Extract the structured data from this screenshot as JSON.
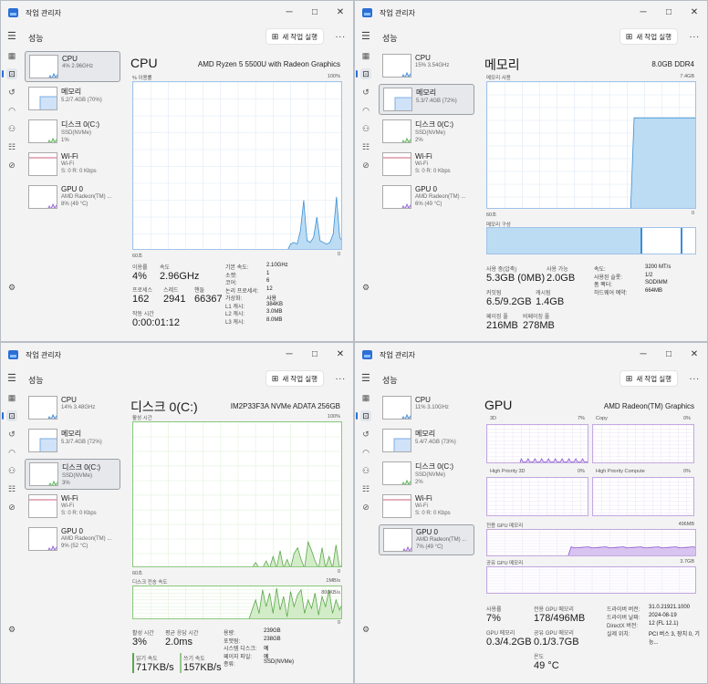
{
  "app": {
    "title": "작업 관리자",
    "section": "성능",
    "run_task": "새 작업 실행",
    "more": "...",
    "min": "─",
    "max": "□",
    "close": "✕"
  },
  "windows": [
    {
      "sidebar": [
        {
          "name": "CPU",
          "sub1": "4% 2.96GHz",
          "sub2": ""
        },
        {
          "name": "메모리",
          "sub1": "5.2/7.4GB (70%)",
          "sub2": ""
        },
        {
          "name": "디스크 0(C:)",
          "sub1": "SSD(NVMe)",
          "sub2": "1%"
        },
        {
          "name": "Wi-Fi",
          "sub1": "Wi-Fi",
          "sub2": "S: 0 R: 0 Kbps"
        },
        {
          "name": "GPU 0",
          "sub1": "AMD Radeon(TM) ...",
          "sub2": "8% (49 °C)"
        }
      ],
      "heading": "CPU",
      "model": "AMD Ryzen 5 5500U with Radeon Graphics",
      "graph_top_left": "% 이용률",
      "graph_top_right": "100%",
      "graph_bot_left": "60초",
      "graph_bot_right": "0",
      "graph_points": [
        0,
        0,
        0,
        0,
        0,
        0,
        0,
        0,
        0,
        0,
        0,
        0,
        0,
        0,
        0,
        0,
        0,
        0,
        0,
        0,
        0,
        0,
        0,
        0,
        0,
        0,
        0,
        0,
        0,
        0,
        0,
        0,
        0,
        0,
        0,
        0,
        0,
        0,
        0,
        0,
        0,
        0,
        0,
        0,
        0,
        0,
        0,
        0,
        4,
        5,
        4,
        12,
        30,
        6,
        5,
        8,
        20,
        6,
        5,
        4,
        5,
        10,
        32,
        8,
        5
      ],
      "stats": {
        "util_label": "이용률",
        "util_val": "4%",
        "speed_label": "속도",
        "speed_val": "2.96GHz",
        "proc_label": "프로세스",
        "proc_val": "162",
        "thread_label": "스레드",
        "thread_val": "2941",
        "handle_label": "핸들",
        "handle_val": "66367",
        "uptime_label": "작동 시간",
        "uptime_val": "0:00:01:12"
      },
      "kv": [
        {
          "k": "기본 속도:",
          "v": "2.10GHz"
        },
        {
          "k": "소켓:",
          "v": "1"
        },
        {
          "k": "코어:",
          "v": "6"
        },
        {
          "k": "논리 프로세서:",
          "v": "12"
        },
        {
          "k": "가상화:",
          "v": "사용"
        },
        {
          "k": "L1 캐시:",
          "v": "384KB"
        },
        {
          "k": "L2 캐시:",
          "v": "3.0MB"
        },
        {
          "k": "L3 캐시:",
          "v": "8.0MB"
        }
      ]
    },
    {
      "sidebar": [
        {
          "name": "CPU",
          "sub1": "15% 3.54GHz",
          "sub2": ""
        },
        {
          "name": "메모리",
          "sub1": "5.3/7.4GB (72%)",
          "sub2": ""
        },
        {
          "name": "디스크 0(C:)",
          "sub1": "SSD(NVMe)",
          "sub2": "2%"
        },
        {
          "name": "Wi-Fi",
          "sub1": "Wi-Fi",
          "sub2": "S: 0 R: 0 Kbps"
        },
        {
          "name": "GPU 0",
          "sub1": "AMD Radeon(TM) ...",
          "sub2": "6% (49 °C)"
        }
      ],
      "heading": "메모리",
      "model": "8.0GB DDR4",
      "graph_top_left": "메모리 사용",
      "graph_top_right": "7.4GB",
      "graph_bot_left": "60초",
      "graph_bot_right": "0",
      "composition_label": "메모리 구성",
      "stats": {
        "inuse_label": "사용 중(압축)",
        "inuse_val": "5.3GB (0MB)",
        "avail_label": "사용 가능",
        "avail_val": "2.0GB",
        "commit_label": "커밋됨",
        "commit_val": "6.5/9.2GB",
        "cache_label": "캐시됨",
        "cache_val": "1.4GB",
        "paged_label": "페이징 풀",
        "paged_val": "216MB",
        "nonpaged_label": "비페이징 풀",
        "nonpaged_val": "278MB"
      },
      "kv": [
        {
          "k": "속도:",
          "v": "3200 MT/s"
        },
        {
          "k": "사용된 슬롯:",
          "v": "1/2"
        },
        {
          "k": "폼 팩터:",
          "v": "SODIMM"
        },
        {
          "k": "하드웨어 예약:",
          "v": "664MB"
        }
      ]
    },
    {
      "sidebar": [
        {
          "name": "CPU",
          "sub1": "14% 3.48GHz",
          "sub2": ""
        },
        {
          "name": "메모리",
          "sub1": "5.3/7.4GB (72%)",
          "sub2": ""
        },
        {
          "name": "디스크 0(C:)",
          "sub1": "SSD(NVMe)",
          "sub2": "3%"
        },
        {
          "name": "Wi-Fi",
          "sub1": "Wi-Fi",
          "sub2": "S: 0 R: 0 Kbps"
        },
        {
          "name": "GPU 0",
          "sub1": "AMD Radeon(TM) ...",
          "sub2": "9% (52 °C)"
        }
      ],
      "heading": "디스크 0(C:)",
      "model": "IM2P33F3A NVMe ADATA 256GB",
      "graph_top_left": "활성 시간",
      "graph_top_right": "100%",
      "graph_bot_left": "60초",
      "graph_bot_right": "0",
      "graph2_left": "디스크 전송 속도",
      "graph2_right": "1MB/s",
      "graph2_inner": "800KB/s",
      "graph2_bot_right": "0",
      "stats": {
        "active_label": "활성 시간",
        "active_val": "3%",
        "resp_label": "평균 응답 시간",
        "resp_val": "2.0ms",
        "read_label": "읽기 속도",
        "read_val": "717KB/s",
        "write_label": "쓰기 속도",
        "write_val": "157KB/s"
      },
      "kv": [
        {
          "k": "용량:",
          "v": "239GB"
        },
        {
          "k": "포맷됨:",
          "v": "238GB"
        },
        {
          "k": "시스템 디스크:",
          "v": "예"
        },
        {
          "k": "페이지 파일:",
          "v": "예"
        },
        {
          "k": "종류:",
          "v": "SSD(NVMe)"
        }
      ]
    },
    {
      "sidebar": [
        {
          "name": "CPU",
          "sub1": "11% 3.10GHz",
          "sub2": ""
        },
        {
          "name": "메모리",
          "sub1": "5.4/7.4GB (73%)",
          "sub2": ""
        },
        {
          "name": "디스크 0(C:)",
          "sub1": "SSD(NVMe)",
          "sub2": "2%"
        },
        {
          "name": "Wi-Fi",
          "sub1": "Wi-Fi",
          "sub2": "S: 0 R: 0 Kbps"
        },
        {
          "name": "GPU 0",
          "sub1": "AMD Radeon(TM) ...",
          "sub2": "7% (49 °C)"
        }
      ],
      "heading": "GPU",
      "model": "AMD Radeon(TM) Graphics",
      "engines": [
        {
          "name": "3D",
          "pct": "7%"
        },
        {
          "name": "Copy",
          "pct": "0%"
        },
        {
          "name": "High Priority 3D",
          "pct": "0%"
        },
        {
          "name": "High Priority Compute",
          "pct": "0%"
        }
      ],
      "dedicated_label": "전용 GPU 메모리",
      "dedicated_max": "496MB",
      "shared_label": "공유 GPU 메모리",
      "shared_max": "3.7GB",
      "stats": {
        "util_label": "사용률",
        "util_val": "7%",
        "ded_label": "전용 GPU 메모리",
        "ded_val": "178/496MB",
        "gpu_mem_label": "GPU 메모리",
        "gpu_mem_val": "0.3/4.2GB",
        "shared_label": "공유 GPU 메모리",
        "shared_val": "0.1/3.7GB",
        "temp_label": "온도",
        "temp_val": "49 °C"
      },
      "kv": [
        {
          "k": "드라이버 버전:",
          "v": "31.0.21921.1000"
        },
        {
          "k": "드라이버 날짜:",
          "v": "2024-08-19"
        },
        {
          "k": "DirectX 버전:",
          "v": "12 (FL 12.1)"
        },
        {
          "k": "실제 위치:",
          "v": "PCI 버스 3, 장치 0, 기능..."
        }
      ]
    }
  ]
}
